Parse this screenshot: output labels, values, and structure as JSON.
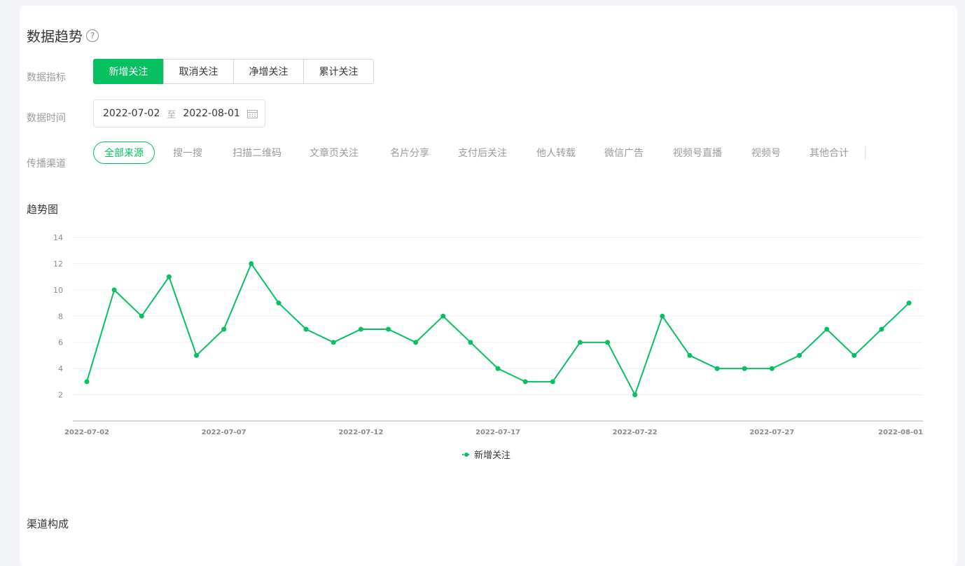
{
  "header": {
    "title": "数据趋势",
    "help_icon": "question-circle-icon"
  },
  "metric": {
    "label": "数据指标",
    "options": [
      "新增关注",
      "取消关注",
      "净增关注",
      "累计关注"
    ],
    "selected": "新增关注"
  },
  "date": {
    "label": "数据时间",
    "start": "2022-07-02",
    "separator": "至",
    "end": "2022-08-01",
    "icon": "calendar-icon"
  },
  "channel": {
    "label": "传播渠道",
    "options": [
      "全部来源",
      "搜一搜",
      "扫描二维码",
      "文章页关注",
      "名片分享",
      "支付后关注",
      "他人转载",
      "微信广告",
      "视频号直播",
      "视频号",
      "其他合计"
    ],
    "selected": "全部来源"
  },
  "trend_title": "趋势图",
  "composition_title": "渠道构成",
  "colors": {
    "accent": "#07c160"
  },
  "chart_data": {
    "type": "line",
    "x": [
      "2022-07-02",
      "2022-07-03",
      "2022-07-04",
      "2022-07-05",
      "2022-07-06",
      "2022-07-07",
      "2022-07-08",
      "2022-07-09",
      "2022-07-10",
      "2022-07-11",
      "2022-07-12",
      "2022-07-13",
      "2022-07-14",
      "2022-07-15",
      "2022-07-16",
      "2022-07-17",
      "2022-07-18",
      "2022-07-19",
      "2022-07-20",
      "2022-07-21",
      "2022-07-22",
      "2022-07-23",
      "2022-07-24",
      "2022-07-25",
      "2022-07-26",
      "2022-07-27",
      "2022-07-28",
      "2022-07-29",
      "2022-07-30",
      "2022-07-31",
      "2022-08-01"
    ],
    "x_tick_labels": [
      "2022-07-02",
      "2022-07-07",
      "2022-07-12",
      "2022-07-17",
      "2022-07-22",
      "2022-07-27",
      "2022-08-01"
    ],
    "series": [
      {
        "name": "新增关注",
        "values": [
          3,
          10,
          8,
          11,
          5,
          7,
          12,
          9,
          7,
          6,
          7,
          7,
          6,
          8,
          6,
          4,
          3,
          3,
          6,
          6,
          2,
          8,
          5,
          4,
          4,
          4,
          5,
          7,
          5,
          7,
          9
        ]
      }
    ],
    "y_ticks": [
      2,
      4,
      6,
      8,
      10,
      12,
      14
    ],
    "ylim": [
      0,
      14
    ],
    "grid": true,
    "legend_position": "bottom-center"
  }
}
